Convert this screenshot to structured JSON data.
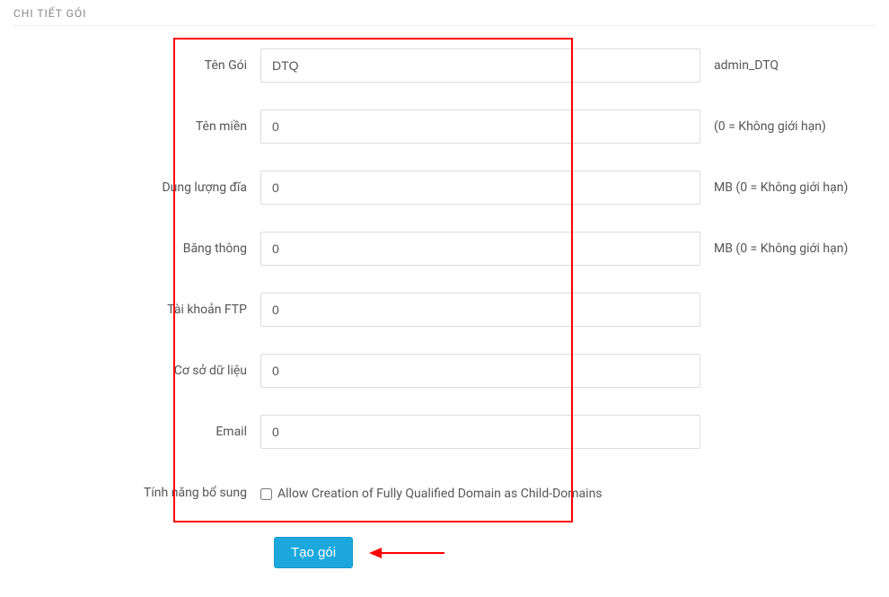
{
  "panel": {
    "title": "CHI TIẾT GÓI"
  },
  "fields": {
    "packageName": {
      "label": "Tên Gói",
      "value": "DTQ",
      "hint": "admin_DTQ"
    },
    "domain": {
      "label": "Tên miền",
      "value": "0",
      "hint": "(0 = Không giới hạn)"
    },
    "diskSpace": {
      "label": "Dung lượng đĩa",
      "value": "0",
      "hint": "MB (0 = Không giới hạn)"
    },
    "bandwidth": {
      "label": "Băng thông",
      "value": "0",
      "hint": "MB (0 = Không giới hạn)"
    },
    "ftp": {
      "label": "Tài khoản FTP",
      "value": "0"
    },
    "database": {
      "label": "Cơ sở dữ liệu",
      "value": "0"
    },
    "email": {
      "label": "Email",
      "value": "0"
    },
    "features": {
      "label": "Tính năng bổ sung",
      "checkboxLabel": "Allow Creation of Fully Qualified Domain as Child-Domains"
    }
  },
  "actions": {
    "createPackage": "Tạo gói"
  },
  "colors": {
    "primary": "#1ca8dd",
    "highlight": "#ff0000"
  }
}
